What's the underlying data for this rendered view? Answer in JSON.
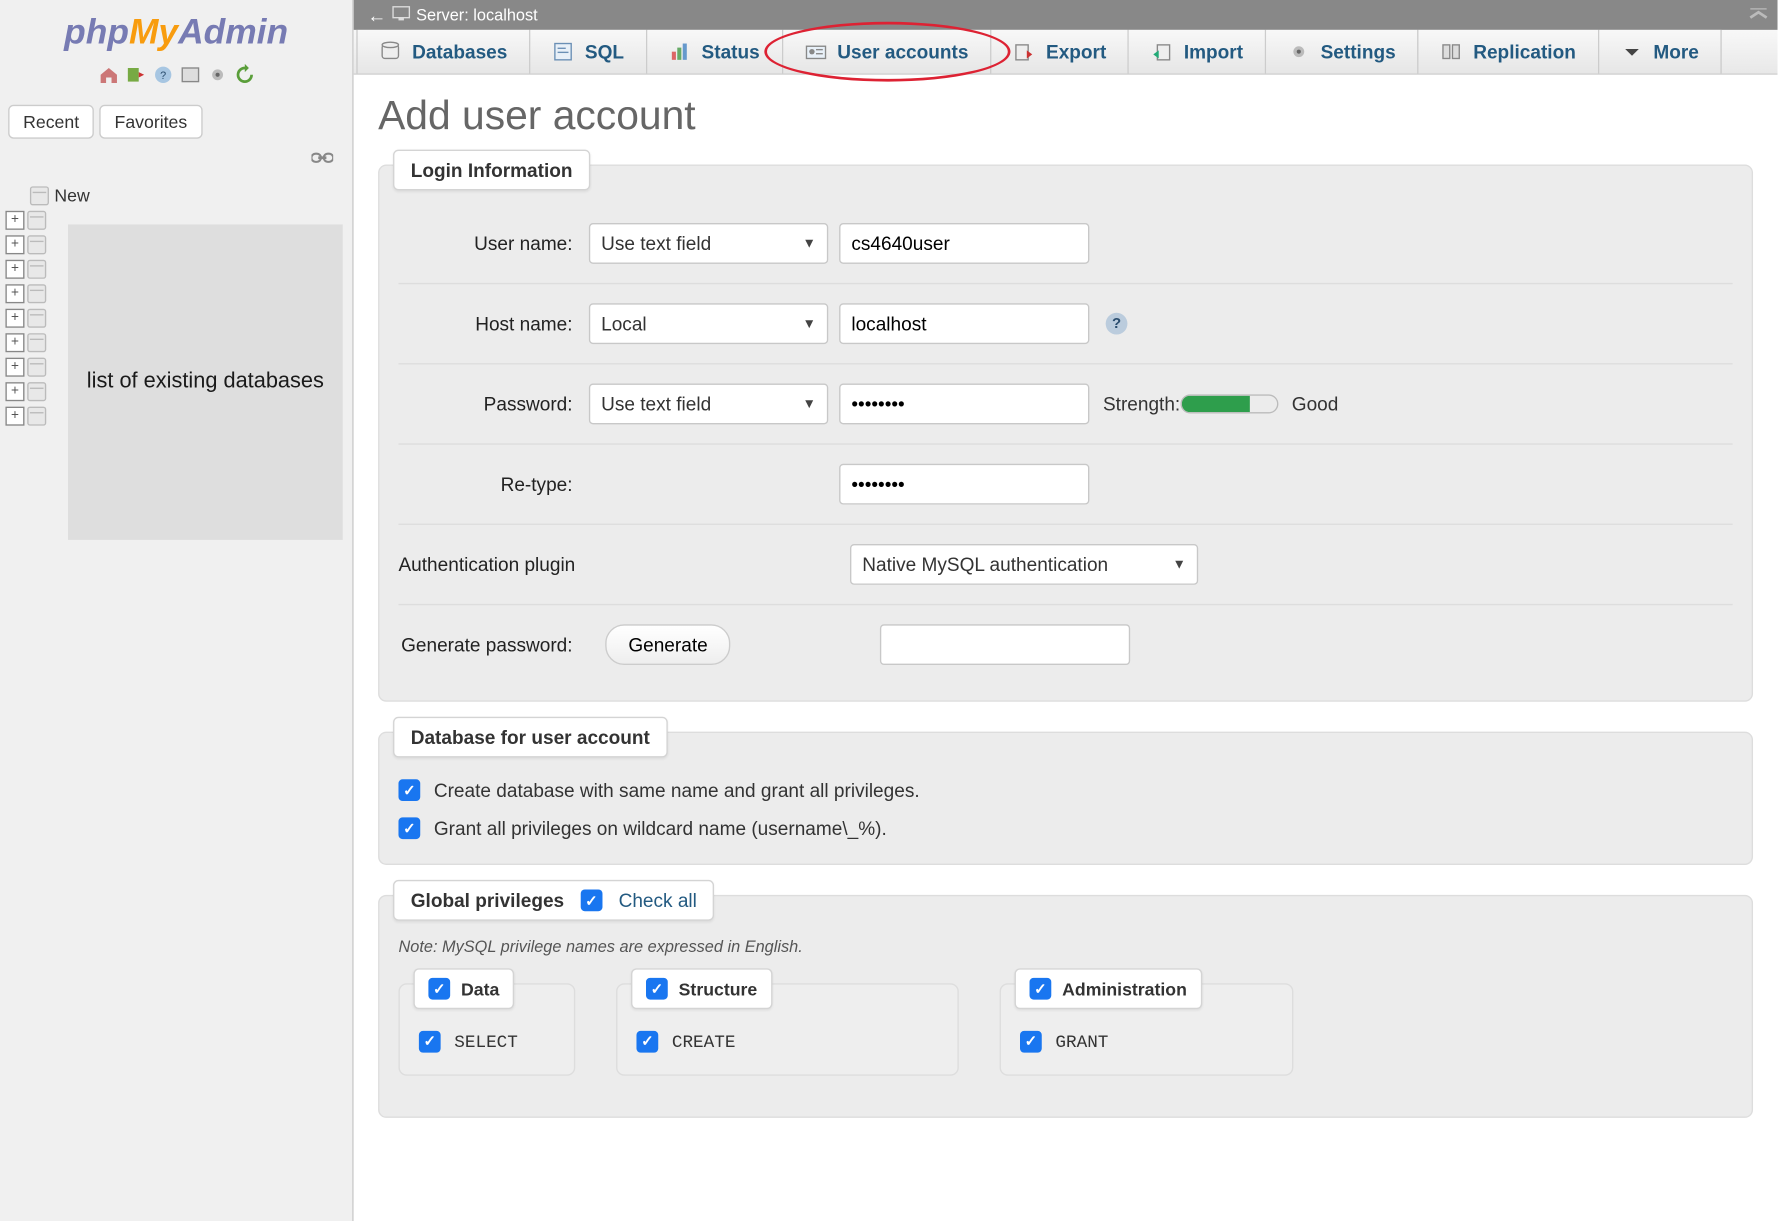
{
  "sidebar": {
    "tabs": {
      "recent": "Recent",
      "favorites": "Favorites"
    },
    "tree": {
      "new_label": "New"
    },
    "overlay": "list of existing databases"
  },
  "topbar": {
    "title": "Server: localhost"
  },
  "main_tabs": [
    {
      "label": "Databases",
      "name": "tab-databases"
    },
    {
      "label": "SQL",
      "name": "tab-sql"
    },
    {
      "label": "Status",
      "name": "tab-status"
    },
    {
      "label": "User accounts",
      "name": "tab-user-accounts",
      "highlighted": true
    },
    {
      "label": "Export",
      "name": "tab-export"
    },
    {
      "label": "Import",
      "name": "tab-import"
    },
    {
      "label": "Settings",
      "name": "tab-settings"
    },
    {
      "label": "Replication",
      "name": "tab-replication"
    },
    {
      "label": "More",
      "name": "tab-more"
    }
  ],
  "page": {
    "title": "Add user account"
  },
  "login": {
    "legend": "Login Information",
    "username_label": "User name:",
    "username_mode": "Use text field",
    "username_value": "cs4640user",
    "hostname_label": "Host name:",
    "hostname_mode": "Local",
    "hostname_value": "localhost",
    "password_label": "Password:",
    "password_mode": "Use text field",
    "password_value": "••••••••",
    "strength_label": "Strength:",
    "strength_text": "Good",
    "retype_label": "Re-type:",
    "retype_value": "••••••••",
    "authplugin_label": "Authentication plugin",
    "authplugin_value": "Native MySQL authentication",
    "genpass_label": "Generate password:",
    "generate_btn": "Generate"
  },
  "db_section": {
    "legend": "Database for user account",
    "opt1": "Create database with same name and grant all privileges.",
    "opt2": "Grant all privileges on wildcard name (username\\_%)."
  },
  "global": {
    "legend": "Global privileges",
    "check_all": "Check all",
    "note": "Note: MySQL privilege names are expressed in English.",
    "groups": {
      "data": {
        "label": "Data",
        "items": [
          "SELECT"
        ]
      },
      "structure": {
        "label": "Structure",
        "items": [
          "CREATE"
        ]
      },
      "administration": {
        "label": "Administration",
        "items": [
          "GRANT"
        ]
      }
    }
  }
}
